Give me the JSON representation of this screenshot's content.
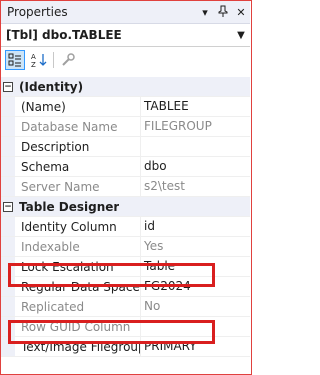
{
  "window": {
    "title": "Properties"
  },
  "object": {
    "name": "[Tbl] dbo.TABLEE"
  },
  "grid": {
    "sections": [
      {
        "label": "(Identity)",
        "rows": [
          {
            "name": "(Name)",
            "value": "TABLEE",
            "readonly": false
          },
          {
            "name": "Database Name",
            "value": "FILEGROUP",
            "readonly": true
          },
          {
            "name": "Description",
            "value": "",
            "readonly": false
          },
          {
            "name": "Schema",
            "value": "dbo",
            "readonly": false
          },
          {
            "name": "Server Name",
            "value": "s2\\test",
            "readonly": true
          }
        ]
      },
      {
        "label": "Table Designer",
        "rows": [
          {
            "name": "Identity Column",
            "value": "id",
            "readonly": false
          },
          {
            "name": "Indexable",
            "value": "Yes",
            "readonly": true
          },
          {
            "name": "Lock Escalation",
            "value": "Table",
            "readonly": false
          },
          {
            "name": "Regular Data Space Sp",
            "value": "FG2024",
            "readonly": false
          },
          {
            "name": "Replicated",
            "value": "No",
            "readonly": true
          },
          {
            "name": "Row GUID Column",
            "value": "",
            "readonly": true
          },
          {
            "name": "Text/Image Filegroup",
            "value": "PRIMARY",
            "readonly": false
          }
        ]
      }
    ]
  }
}
